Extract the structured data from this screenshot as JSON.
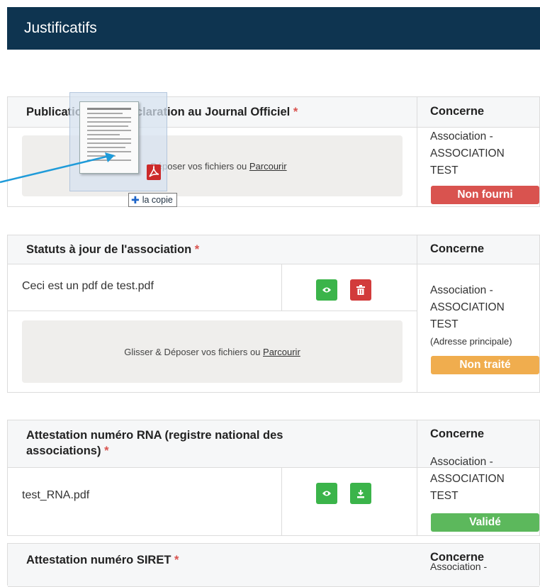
{
  "header": {
    "title": "Justificatifs"
  },
  "sections": [
    {
      "title": "Publication de la déclaration au Journal Officiel",
      "concerne_label": "Concerne",
      "dropzone": {
        "text": "Glisser & Déposer vos fichiers ou",
        "link": "Parcourir"
      },
      "assoc": [
        "Association -",
        "ASSOCIATION",
        "TEST"
      ],
      "status": {
        "label": "Non fourni",
        "color": "#d9534f"
      }
    },
    {
      "title": "Statuts à jour de l'association",
      "concerne_label": "Concerne",
      "file": "Ceci est un pdf de test.pdf",
      "dropzone": {
        "text": "Glisser & Déposer vos fichiers ou",
        "link": "Parcourir"
      },
      "assoc": [
        "Association -",
        "ASSOCIATION",
        "TEST"
      ],
      "assoc_note": "(Adresse principale)",
      "status": {
        "label": "Non traité",
        "color": "#f0ad4e"
      }
    },
    {
      "title_line1": "Attestation numéro RNA (registre national des",
      "title_line2": "associations)",
      "concerne_label": "Concerne",
      "file": "test_RNA.pdf",
      "assoc": [
        "Association -",
        "ASSOCIATION",
        "TEST"
      ],
      "status": {
        "label": "Validé",
        "color": "#5cb85c"
      }
    },
    {
      "title": "Attestation numéro SIRET",
      "concerne_label": "Concerne",
      "assoc": [
        "Association -"
      ]
    }
  ],
  "required_mark": "*",
  "drag": {
    "tooltip": "la copie",
    "visible_dropzone_text": "Déposer vos fichiers ou"
  },
  "icons": {
    "view": "eye-icon",
    "delete": "trash-icon",
    "download": "download-icon",
    "pdf": "pdf-icon"
  }
}
